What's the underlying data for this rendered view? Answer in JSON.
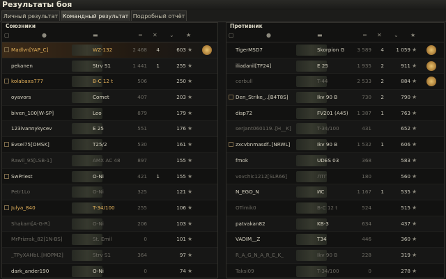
{
  "window_title": "Результаты боя",
  "tabs": [
    {
      "label": "Личный результат",
      "active": false
    },
    {
      "label": "Командный результат",
      "active": true
    },
    {
      "label": "Подробный отчёт",
      "active": false
    }
  ],
  "allies": {
    "title": "Союзники",
    "rows": [
      {
        "name": "Madlvn[YAP_C]",
        "tank": "WZ-132",
        "damage": "2 468",
        "kills": "4",
        "xp": "603",
        "clan": true,
        "me": true,
        "medal": true,
        "tone": "y"
      },
      {
        "name": "pekanen",
        "tank": "Strv S1",
        "damage": "1 441",
        "kills": "1",
        "xp": "255",
        "clan": false,
        "me": false,
        "medal": false,
        "tone": "w"
      },
      {
        "name": "kolabaxa777",
        "tank": "B-C 12 t",
        "damage": "506",
        "kills": "",
        "xp": "250",
        "clan": true,
        "me": false,
        "medal": false,
        "tone": "y"
      },
      {
        "name": "oyavors",
        "tank": "Comet",
        "damage": "407",
        "kills": "",
        "xp": "203",
        "clan": false,
        "me": false,
        "medal": false,
        "tone": "w"
      },
      {
        "name": "biven_100[W-SP]",
        "tank": "Leo",
        "damage": "879",
        "kills": "",
        "xp": "179",
        "clan": false,
        "me": false,
        "medal": false,
        "tone": "w"
      },
      {
        "name": "123ivannykycev",
        "tank": "E 25",
        "damage": "551",
        "kills": "",
        "xp": "176",
        "clan": false,
        "me": false,
        "medal": false,
        "tone": "w"
      },
      {
        "name": "Evsei75[OMSK]",
        "tank": "T25/2",
        "damage": "530",
        "kills": "",
        "xp": "161",
        "clan": true,
        "me": false,
        "medal": false,
        "tone": "w"
      },
      {
        "name": "Rawil_95[LSB-1]",
        "tank": "AMX AC 48",
        "damage": "897",
        "kills": "",
        "xp": "155",
        "clan": false,
        "me": false,
        "medal": false,
        "tone": "g"
      },
      {
        "name": "SwPriest",
        "tank": "O-Ni",
        "damage": "421",
        "kills": "1",
        "xp": "155",
        "clan": true,
        "me": false,
        "medal": false,
        "tone": "w"
      },
      {
        "name": "Petr1Lo",
        "tank": "O-Ni",
        "damage": "325",
        "kills": "",
        "xp": "121",
        "clan": false,
        "me": false,
        "medal": false,
        "tone": "g"
      },
      {
        "name": "Julya_840",
        "tank": "T-34/100",
        "damage": "255",
        "kills": "",
        "xp": "106",
        "clan": true,
        "me": false,
        "medal": false,
        "tone": "y"
      },
      {
        "name": "Shakam[A-G-R]",
        "tank": "O-Ni",
        "damage": "206",
        "kills": "",
        "xp": "103",
        "clan": false,
        "me": false,
        "medal": false,
        "tone": "g"
      },
      {
        "name": "MrPrizrak_82[1N-BS]",
        "tank": "St. Emil",
        "damage": "0",
        "kills": "",
        "xp": "101",
        "clan": false,
        "me": false,
        "medal": false,
        "tone": "g"
      },
      {
        "name": "_TPyXAHbI..[HOPM2]",
        "tank": "Strv S1",
        "damage": "364",
        "kills": "",
        "xp": "97",
        "clan": false,
        "me": false,
        "medal": false,
        "tone": "g"
      },
      {
        "name": "dark_ander190",
        "tank": "O-Ni",
        "damage": "0",
        "kills": "",
        "xp": "74",
        "clan": false,
        "me": false,
        "medal": false,
        "tone": "w"
      }
    ]
  },
  "enemies": {
    "title": "Противник",
    "rows": [
      {
        "name": "TigerMSD7",
        "tank": "Skorpion G",
        "damage": "3 589",
        "kills": "4",
        "xp": "1 059",
        "clan": false,
        "medal": true,
        "tone": "w"
      },
      {
        "name": "iliadanil[TF24]",
        "tank": "E 25",
        "damage": "1 935",
        "kills": "2",
        "xp": "911",
        "clan": false,
        "medal": true,
        "tone": "w"
      },
      {
        "name": "cerbull",
        "tank": "T-44",
        "damage": "2 533",
        "kills": "2",
        "xp": "884",
        "clan": false,
        "medal": true,
        "tone": "g"
      },
      {
        "name": "Den_Strike_..[B4T8S]",
        "tank": "Ikv 90 B",
        "damage": "730",
        "kills": "2",
        "xp": "790",
        "clan": true,
        "medal": false,
        "tone": "w"
      },
      {
        "name": "disp72",
        "tank": "FV201 (A45)",
        "damage": "1 387",
        "kills": "1",
        "xp": "763",
        "clan": false,
        "medal": false,
        "tone": "w"
      },
      {
        "name": "serjant060119..[H__K]",
        "tank": "T-34/100",
        "damage": "431",
        "kills": "",
        "xp": "652",
        "clan": false,
        "medal": false,
        "tone": "g"
      },
      {
        "name": "zxcvbnmasdf..[NRWL]",
        "tank": "Ikv 90 B",
        "damage": "1 532",
        "kills": "1",
        "xp": "606",
        "clan": true,
        "medal": false,
        "tone": "w"
      },
      {
        "name": "fmok",
        "tank": "UDES 03",
        "damage": "368",
        "kills": "",
        "xp": "583",
        "clan": false,
        "medal": false,
        "tone": "w"
      },
      {
        "name": "vovchic1212[SLR66]",
        "tank": "ЛТГ",
        "damage": "180",
        "kills": "",
        "xp": "560",
        "clan": false,
        "medal": false,
        "tone": "g"
      },
      {
        "name": "N_EGO_N",
        "tank": "ИС",
        "damage": "1 167",
        "kills": "1",
        "xp": "535",
        "clan": false,
        "medal": false,
        "tone": "w"
      },
      {
        "name": "OTimik0",
        "tank": "B-C 12 t",
        "damage": "524",
        "kills": "",
        "xp": "515",
        "clan": false,
        "medal": false,
        "tone": "g"
      },
      {
        "name": "patvakan82",
        "tank": "KB-3",
        "damage": "634",
        "kills": "",
        "xp": "437",
        "clan": false,
        "medal": false,
        "tone": "w"
      },
      {
        "name": "VADIM__Z",
        "tank": "T34",
        "damage": "446",
        "kills": "",
        "xp": "360",
        "clan": false,
        "medal": false,
        "tone": "w"
      },
      {
        "name": "R_A_G_N_A_R_E_K_",
        "tank": "Ikv 90 B",
        "damage": "228",
        "kills": "",
        "xp": "319",
        "clan": false,
        "medal": false,
        "tone": "g"
      },
      {
        "name": "Taksi09",
        "tank": "T-34/100",
        "damage": "0",
        "kills": "",
        "xp": "278",
        "clan": false,
        "medal": false,
        "tone": "g"
      }
    ]
  }
}
